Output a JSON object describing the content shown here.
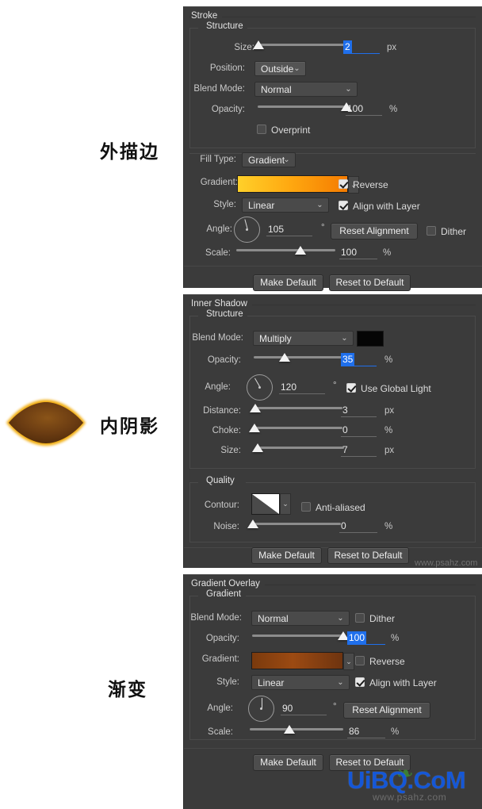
{
  "annotations": {
    "stroke_label": "外描边",
    "inner_shadow_label": "内阴影",
    "gradient_label": "渐变"
  },
  "artwork": {
    "name": "lens-shape-preview",
    "fill_dark": "#4a2709",
    "fill_mid": "#6b3c12",
    "fill_light": "#8a5418",
    "stroke_outer": "#f0a800",
    "stroke_inner": "#ffd34d"
  },
  "watermark": {
    "primary": "UiBQ.CoM",
    "secondary": "www.psahz.com",
    "right_note": "www.psahz.com",
    "color": "#1557d6"
  },
  "units": {
    "px": "px",
    "percent": "%",
    "degree": "°"
  },
  "stroke_panel": {
    "title": "Stroke",
    "structure_group": "Structure",
    "size": {
      "label": "Size:",
      "value": "2",
      "unit": "px",
      "slider_pct": 2,
      "selected": true
    },
    "position": {
      "label": "Position:",
      "value": "Outside"
    },
    "blend_mode": {
      "label": "Blend Mode:",
      "value": "Normal"
    },
    "opacity": {
      "label": "Opacity:",
      "value": "100",
      "unit": "%",
      "slider_pct": 100
    },
    "overprint": {
      "label": "Overprint",
      "checked": false
    },
    "fill_type": {
      "label": "Fill Type:",
      "value": "Gradient"
    },
    "gradient": {
      "label": "Gradient:",
      "stop_start": "#ffd02a",
      "stop_mid": "#ffa810",
      "stop_end": "#f47b00"
    },
    "reverse": {
      "label": "Reverse",
      "checked": true
    },
    "style": {
      "label": "Style:",
      "value": "Linear"
    },
    "align_with_layer": {
      "label": "Align with Layer",
      "checked": true
    },
    "angle": {
      "label": "Angle:",
      "value": "105",
      "unit": "°",
      "dial_deg": 105
    },
    "reset_alignment": "Reset Alignment",
    "dither": {
      "label": "Dither",
      "checked": false
    },
    "scale": {
      "label": "Scale:",
      "value": "100",
      "unit": "%",
      "slider_pct": 65
    },
    "make_default": "Make Default",
    "reset_to_default": "Reset to Default"
  },
  "inner_shadow_panel": {
    "title": "Inner Shadow",
    "structure_group": "Structure",
    "blend_mode": {
      "label": "Blend Mode:",
      "value": "Multiply"
    },
    "color": {
      "value": "#050505"
    },
    "opacity": {
      "label": "Opacity:",
      "value": "35",
      "unit": "%",
      "slider_pct": 35,
      "selected": true
    },
    "angle": {
      "label": "Angle:",
      "value": "120",
      "unit": "°",
      "dial_deg": 120
    },
    "use_global_light": {
      "label": "Use Global Light",
      "checked": true
    },
    "distance": {
      "label": "Distance:",
      "value": "3",
      "unit": "px",
      "slider_pct": 2
    },
    "choke": {
      "label": "Choke:",
      "value": "0",
      "unit": "%",
      "slider_pct": 0
    },
    "size": {
      "label": "Size:",
      "value": "7",
      "unit": "px",
      "slider_pct": 4
    },
    "quality_group": "Quality",
    "contour": {
      "label": "Contour:"
    },
    "anti_aliased": {
      "label": "Anti-aliased",
      "checked": false
    },
    "noise": {
      "label": "Noise:",
      "value": "0",
      "unit": "%",
      "slider_pct": 0
    },
    "make_default": "Make Default",
    "reset_to_default": "Reset to Default"
  },
  "gradient_overlay_panel": {
    "title": "Gradient Overlay",
    "gradient_group": "Gradient",
    "blend_mode": {
      "label": "Blend Mode:",
      "value": "Normal"
    },
    "dither": {
      "label": "Dither",
      "checked": false
    },
    "opacity": {
      "label": "Opacity:",
      "value": "100",
      "unit": "%",
      "slider_pct": 100,
      "selected": true
    },
    "gradient": {
      "label": "Gradient:",
      "stop_start": "#7a3a0d",
      "stop_mid": "#9c4a12",
      "stop_end": "#6e3410"
    },
    "reverse": {
      "label": "Reverse",
      "checked": false
    },
    "style": {
      "label": "Style:",
      "value": "Linear"
    },
    "align_with_layer": {
      "label": "Align with Layer",
      "checked": true
    },
    "angle": {
      "label": "Angle:",
      "value": "90",
      "unit": "°",
      "dial_deg": 90
    },
    "reset_alignment": "Reset Alignment",
    "scale": {
      "label": "Scale:",
      "value": "86",
      "unit": "%",
      "slider_pct": 42
    },
    "make_default": "Make Default",
    "reset_to_default": "Reset to Default"
  }
}
